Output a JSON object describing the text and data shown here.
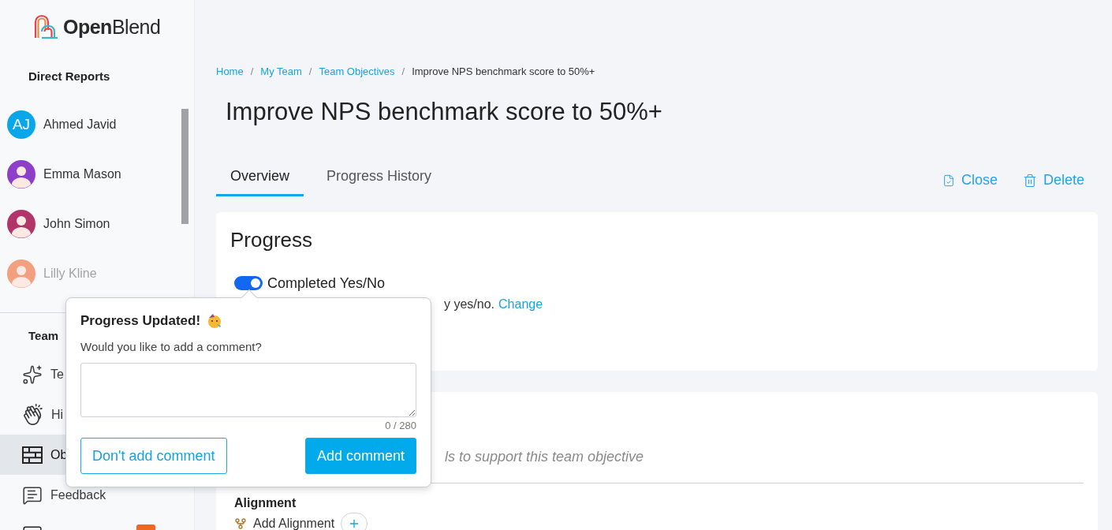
{
  "logo": {
    "text": "**Open**Blend"
  },
  "sidebar": {
    "direct_reports": {
      "heading": "Direct Reports",
      "items": [
        {
          "name": "Ahmed Javid",
          "kind": "initials",
          "initials": "AJ",
          "dimmed": false
        },
        {
          "name": "Emma Mason",
          "kind": "photo",
          "color": "#8e3fc9",
          "dimmed": false
        },
        {
          "name": "John Simon",
          "kind": "photo",
          "color": "#b2356a",
          "dimmed": false
        },
        {
          "name": "Lilly Kline",
          "kind": "photo",
          "color": "#f3a07f",
          "dimmed": true
        }
      ]
    },
    "team": {
      "heading": "Team",
      "items": [
        {
          "label": "Te",
          "kind": "sparkles",
          "selected": false
        },
        {
          "label": "Hi",
          "kind": "clap",
          "selected": false
        },
        {
          "label": "Ob",
          "kind": "rows",
          "selected": true
        },
        {
          "label": "Feedback",
          "kind": "chat",
          "selected": false
        },
        {
          "kind": "screen",
          "selected": false,
          "badge": true
        }
      ]
    }
  },
  "breadcrumb": [
    {
      "kind": "link",
      "label": "Home"
    },
    {
      "kind": "separator",
      "label": "/"
    },
    {
      "kind": "link",
      "label": "My Team"
    },
    {
      "kind": "separator",
      "label": "/"
    },
    {
      "kind": "link",
      "label": "Team Objectives"
    },
    {
      "kind": "separator",
      "label": "/"
    },
    {
      "kind": "current",
      "label": "Improve NPS benchmark score to 50%+"
    }
  ],
  "title": "Improve NPS benchmark score to 50%+",
  "tabs": [
    {
      "label": "Overview",
      "selected": true
    },
    {
      "label": "Progress History",
      "selected": false
    }
  ],
  "actions": [
    {
      "label": "Close",
      "kind": "close"
    },
    {
      "label": "Delete",
      "kind": "delete"
    }
  ],
  "progress_card": {
    "title": "Progress",
    "toggle": {
      "label": "Completed Yes/No",
      "on": true
    },
    "description": "y yes/no.",
    "link": "Change"
  },
  "goals_card": {
    "hint": "ls to support this team objective",
    "section": "Alignment",
    "action": "Add Alignment"
  },
  "popover": {
    "title": "Progress Updated!",
    "prompt": "Would you like to add a comment?",
    "counter": "0 / 280",
    "buttons": [
      {
        "label": "Don't add comment",
        "kind": "secondary"
      },
      {
        "label": "Add comment",
        "kind": "primary"
      }
    ]
  }
}
